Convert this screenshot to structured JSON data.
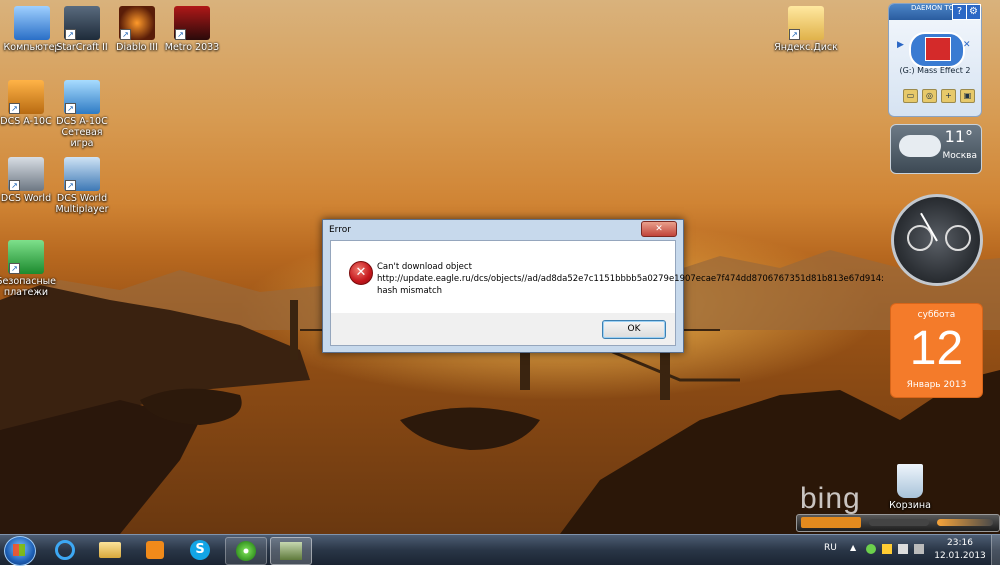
{
  "desktop": {
    "icons": [
      {
        "label": "Компьютер",
        "icon": "computer-icon"
      },
      {
        "label": "StarCraft II",
        "icon": "starcraft-icon"
      },
      {
        "label": "Diablo III",
        "icon": "diablo-icon"
      },
      {
        "label": "Metro 2033",
        "icon": "metro-icon"
      },
      {
        "label": "Яндекс.Диск",
        "icon": "yandex-disk-icon"
      },
      {
        "label": "DCS A-10C",
        "icon": "dcs-a10c-icon"
      },
      {
        "label": "DCS A-10C Сетевая игра",
        "icon": "dcs-a10c-multiplayer-icon"
      },
      {
        "label": "DCS World",
        "icon": "dcs-world-icon"
      },
      {
        "label": "DCS World Multiplayer",
        "icon": "dcs-world-multiplayer-icon"
      },
      {
        "label": "Безопасные платежи",
        "icon": "safe-payments-icon"
      },
      {
        "label": "Корзина",
        "icon": "recycle-bin-icon"
      }
    ],
    "watermark": "bing"
  },
  "gadgets": {
    "daemon_tools": {
      "brand": "DAEMON TOOLS",
      "drive": "(G:) Mass Effect 2"
    },
    "weather": {
      "temp": "11°",
      "city": "Москва"
    },
    "calendar": {
      "weekday": "суббота",
      "day": "12",
      "month_year": "Январь 2013"
    }
  },
  "dialog": {
    "title": "Error",
    "close_glyph": "✕",
    "message": "Can't download object http://update.eagle.ru/dcs/objects//ad/ad8da52e7c1151bbbb5a0279e1907ecae7f474dd8706767351d81b813e67d914: hash mismatch",
    "ok_label": "OK"
  },
  "taskbar": {
    "apps": [
      "internet-explorer-icon",
      "explorer-icon",
      "media-player-icon",
      "skype-icon",
      "icq-icon",
      "dcs-icon"
    ],
    "tray": {
      "lang": "RU",
      "time": "23:16",
      "date": "12.01.2013"
    }
  },
  "colors": {
    "dialog_bg": "#c7d9ec",
    "calendar": "#f47b2a",
    "accent": "#1d5fb5"
  }
}
